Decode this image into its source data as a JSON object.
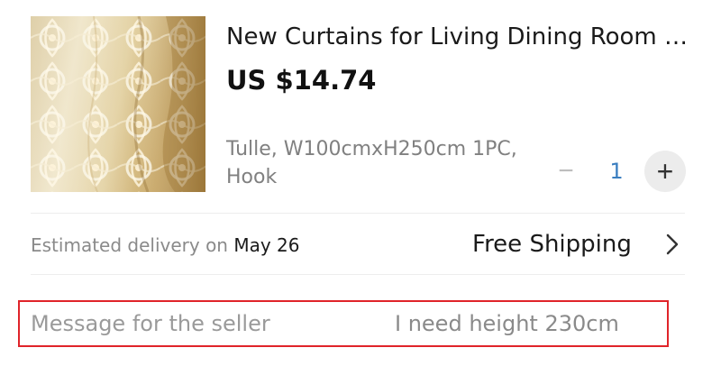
{
  "product": {
    "title": "New Curtains for Living Dining Room B...",
    "price": "US $14.74",
    "variant": "Tulle, W100cmxH250cm 1PC, Hook",
    "image_icon": "curtain-product-image"
  },
  "quantity": {
    "minus_label": "−",
    "value": "1",
    "plus_label": "+"
  },
  "delivery": {
    "label": "Estimated delivery on",
    "date": "May 26",
    "shipping": "Free Shipping",
    "chevron_icon": "chevron-right-icon"
  },
  "message": {
    "label": "Message for the seller",
    "value": "I need height 230cm"
  },
  "colors": {
    "qty_accent": "#3a7ec0",
    "highlight_border": "#e0242a"
  }
}
